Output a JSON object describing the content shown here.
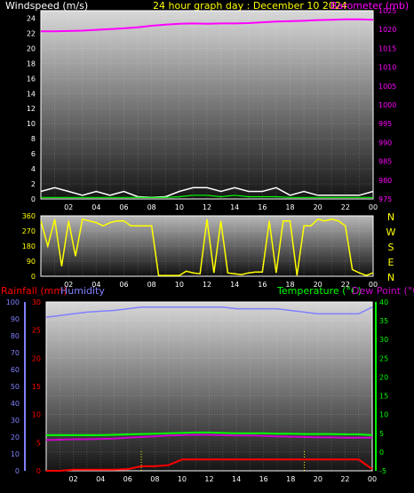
{
  "header": {
    "left": "Windspeed (m/s)",
    "center": "24 hour graph day : December 10 2024",
    "right": "Barometer (mb)"
  },
  "colors": {
    "windspeed": "#ffffff",
    "gust": "#00ff00",
    "barometer": "#ff00ff",
    "direction": "#ffff00",
    "rainfall": "#ff0000",
    "humidity": "#8080ff",
    "temperature": "#00ff00",
    "dewpoint": "#cc00cc",
    "title": "#ffff00"
  },
  "x_ticks": [
    "02",
    "04",
    "06",
    "08",
    "10",
    "12",
    "14",
    "16",
    "18",
    "20",
    "22",
    "00"
  ],
  "compass_labels": [
    "N",
    "W",
    "S",
    "E",
    "N"
  ],
  "chart_data": [
    {
      "type": "line",
      "title": "24 hour graph day : December 10 2024",
      "xlabel": "",
      "ylabel": "Windspeed (m/s)",
      "ylabel_right": "Barometer (mb)",
      "x_hours": [
        0,
        1,
        2,
        3,
        4,
        5,
        6,
        7,
        8,
        9,
        10,
        11,
        12,
        13,
        14,
        15,
        16,
        17,
        18,
        19,
        20,
        21,
        22,
        23,
        24
      ],
      "ylim": [
        0,
        25
      ],
      "ylim_right": [
        975,
        1025
      ],
      "y_ticks": [
        "0",
        "2",
        "4",
        "6",
        "8",
        "10",
        "12",
        "14",
        "16",
        "18",
        "20",
        "22",
        "24"
      ],
      "y_ticks_right": [
        "975",
        "980",
        "985",
        "990",
        "995",
        "1000",
        "1005",
        "1010",
        "1015",
        "1020",
        "1025"
      ],
      "series": [
        {
          "name": "Windspeed (m/s)",
          "axis": "left",
          "values": [
            1,
            1.5,
            1,
            0.5,
            1,
            0.5,
            1,
            0.3,
            0.2,
            0.3,
            1,
            1.5,
            1.5,
            1,
            1.5,
            1,
            1,
            1.5,
            0.5,
            1,
            0.5,
            0.5,
            0.5,
            0.5,
            1
          ]
        },
        {
          "name": "Gust",
          "axis": "left",
          "values": [
            0.2,
            0.2,
            0.2,
            0.2,
            0.2,
            0.2,
            0.2,
            0.2,
            0.2,
            0.2,
            0.3,
            0.5,
            0.5,
            0.3,
            0.5,
            0.3,
            0.3,
            0.3,
            0.2,
            0.2,
            0.2,
            0.2,
            0.2,
            0.2,
            0.2
          ]
        },
        {
          "name": "Barometer (mb)",
          "axis": "right",
          "values": [
            1019.5,
            1019.5,
            1019.6,
            1019.7,
            1019.9,
            1020.1,
            1020.3,
            1020.6,
            1021,
            1021.3,
            1021.5,
            1021.6,
            1021.5,
            1021.6,
            1021.6,
            1021.7,
            1021.9,
            1022.1,
            1022.2,
            1022.3,
            1022.5,
            1022.6,
            1022.7,
            1022.7,
            1022.6
          ]
        }
      ]
    },
    {
      "type": "line",
      "ylabel": "",
      "ylim": [
        0,
        360
      ],
      "y_ticks": [
        "0",
        "90",
        "180",
        "270",
        "360"
      ],
      "x_hours": [
        0,
        0.5,
        1,
        1.5,
        2,
        2.5,
        3,
        3.5,
        4,
        4.5,
        5,
        5.5,
        6,
        6.5,
        7,
        7.5,
        8,
        8.5,
        9,
        9.5,
        10,
        10.5,
        11,
        11.5,
        12,
        12.5,
        13,
        13.5,
        14,
        14.5,
        15,
        15.5,
        16,
        16.5,
        17,
        17.5,
        18,
        18.5,
        19,
        19.5,
        20,
        20.5,
        21,
        21.5,
        22,
        22.5,
        23,
        23.5,
        24
      ],
      "series": [
        {
          "name": "Wind direction",
          "values": [
            330,
            180,
            340,
            60,
            330,
            120,
            340,
            330,
            320,
            300,
            320,
            330,
            330,
            300,
            300,
            300,
            300,
            5,
            5,
            5,
            5,
            30,
            20,
            15,
            340,
            20,
            330,
            20,
            15,
            10,
            20,
            25,
            25,
            330,
            20,
            330,
            330,
            5,
            300,
            300,
            340,
            330,
            340,
            330,
            300,
            40,
            20,
            5,
            20
          ]
        }
      ]
    },
    {
      "type": "line",
      "ylabel": "Rainfall (mm)",
      "ylabel_humidity": "Humidity",
      "ylabel_right": "Temperature (°C)",
      "ylabel_right2": "Dew Point (°C)",
      "x_hours": [
        0,
        1,
        2,
        3,
        4,
        5,
        6,
        7,
        8,
        9,
        10,
        11,
        12,
        13,
        14,
        15,
        16,
        17,
        18,
        19,
        20,
        21,
        22,
        23,
        24
      ],
      "ylim_rain": [
        0,
        30
      ],
      "y_ticks_rain": [
        "0",
        "5",
        "10",
        "15",
        "20",
        "25",
        "30"
      ],
      "ylim_humidity": [
        0,
        100
      ],
      "y_ticks_humidity": [
        "0",
        "10",
        "20",
        "30",
        "40",
        "50",
        "60",
        "70",
        "80",
        "90",
        "100"
      ],
      "ylim_temp": [
        -5,
        40
      ],
      "y_ticks_temp": [
        "-5",
        "0",
        "5",
        "10",
        "15",
        "20",
        "25",
        "30",
        "35",
        "40"
      ],
      "series": [
        {
          "name": "Rainfall (mm)",
          "axis": "rain",
          "values": [
            0,
            0,
            0.2,
            0.2,
            0.2,
            0.2,
            0.3,
            0.8,
            0.8,
            1,
            2,
            2,
            2,
            2,
            2,
            2,
            2,
            2,
            2,
            2,
            2,
            2,
            2,
            2,
            0.3
          ]
        },
        {
          "name": "Humidity",
          "axis": "humidity",
          "values": [
            91,
            92,
            93,
            94,
            94.5,
            95,
            96,
            97,
            97,
            97,
            97,
            97,
            97,
            97,
            96,
            96,
            96,
            96,
            95,
            94,
            93,
            93,
            93,
            93,
            97
          ]
        },
        {
          "name": "Temperature (°C)",
          "axis": "temp",
          "values": [
            4.5,
            4.5,
            4.5,
            4.5,
            4.5,
            4.6,
            4.7,
            4.8,
            4.9,
            5,
            5.1,
            5.2,
            5.2,
            5.1,
            5,
            5,
            5,
            4.9,
            4.9,
            4.8,
            4.8,
            4.8,
            4.7,
            4.7,
            4.5
          ]
        },
        {
          "name": "Dew Point (°C)",
          "axis": "temp",
          "values": [
            3.2,
            3.3,
            3.4,
            3.4,
            3.5,
            3.6,
            3.8,
            4,
            4.2,
            4.4,
            4.5,
            4.6,
            4.6,
            4.5,
            4.4,
            4.4,
            4.3,
            4.2,
            4.1,
            4,
            3.9,
            3.9,
            3.8,
            3.8,
            3.8
          ]
        }
      ]
    }
  ],
  "bottom_rain_markers": [
    7,
    19
  ]
}
